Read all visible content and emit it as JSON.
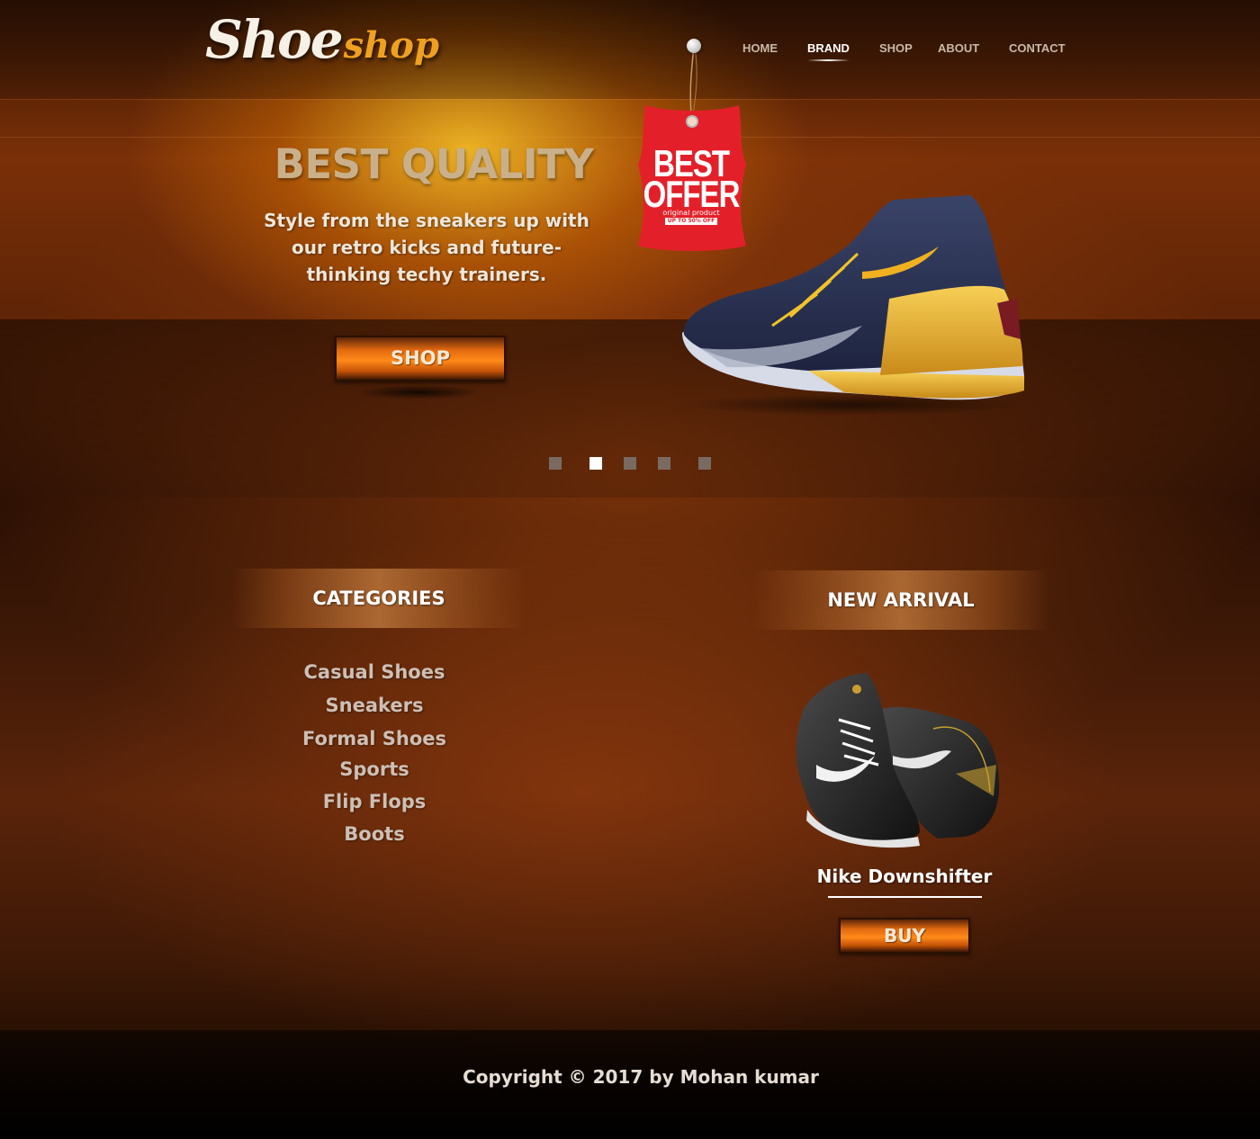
{
  "brand": {
    "logo_main": "Shoe",
    "logo_accent": "shop"
  },
  "nav": {
    "items": [
      {
        "label": "HOME",
        "active": false
      },
      {
        "label": "BRAND",
        "active": true
      },
      {
        "label": "SHOP",
        "active": false
      },
      {
        "label": "ABOUT",
        "active": false
      },
      {
        "label": "CONTACT",
        "active": false
      }
    ]
  },
  "hero": {
    "title": "BEST QUALITY",
    "text": "Style from the sneakers up with our retro kicks and future-thinking techy trainers.",
    "button_label": "SHOP",
    "tag": {
      "line1": "BEST",
      "line2": "OFFER",
      "sub1": "original product",
      "sub2": "UP TO 50% OFF",
      "color": "#e3202a"
    },
    "slider": {
      "count": 5,
      "active_index": 1
    }
  },
  "categories": {
    "header": "CATEGORIES",
    "items": [
      "Casual Shoes",
      "Sneakers",
      "Formal Shoes",
      "Sports",
      "Flip Flops",
      "Boots"
    ]
  },
  "new_arrival": {
    "header": "NEW ARRIVAL",
    "product_name": "Nike Downshifter",
    "button_label": "BUY"
  },
  "footer": {
    "copyright": "Copyright © 2017 by Mohan kumar"
  },
  "colors": {
    "accent": "#ff8a18",
    "logo_accent": "#f0a020",
    "hero_title": "#c9b08a",
    "text_light": "#cdbfb4"
  },
  "icons": [
    "slider-dot-icon",
    "price-tag-icon",
    "pin-icon"
  ]
}
